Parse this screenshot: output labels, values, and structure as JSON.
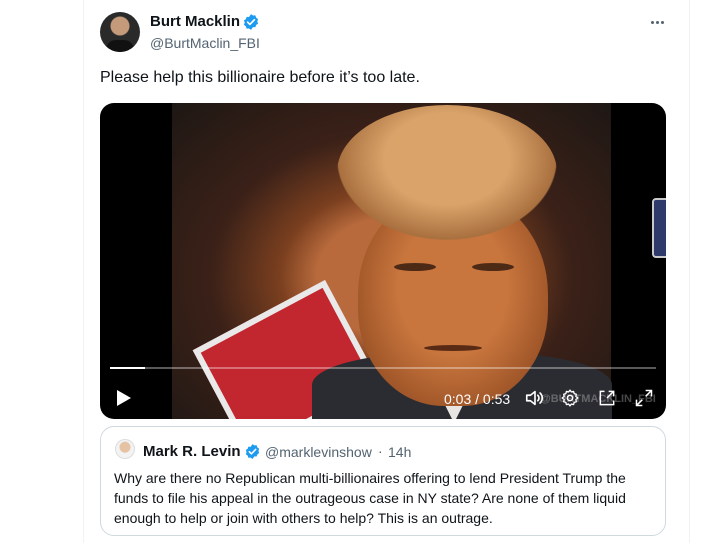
{
  "tweet": {
    "author_name": "Burt Macklin",
    "author_handle": "@BurtMaclin_FBI",
    "text": "Please help this billionaire before it’s too late."
  },
  "video": {
    "timecode": "0:03 / 0:53",
    "progress_fraction": 0.064,
    "watermark": "@BURTMACKLIN_FBI"
  },
  "quoted_tweet": {
    "author_name": "Mark R. Levin",
    "author_handle": "@marklevinshow",
    "separator": "·",
    "time": "14h",
    "text": "Why are there no Republican multi-billionaires offering to lend President Trump the funds to file his appeal in the outrageous case in NY state? Are none of them liquid enough to help or join with others to help?  This is an outrage."
  },
  "colors": {
    "verified_blue": "#1d9bf0",
    "text_primary": "#0f1419",
    "text_secondary": "#536471",
    "border": "#cfd9de"
  },
  "icons": [
    "verified-icon",
    "more-icon",
    "play-icon",
    "volume-icon",
    "settings-icon",
    "picture-in-picture-icon",
    "fullscreen-icon"
  ]
}
